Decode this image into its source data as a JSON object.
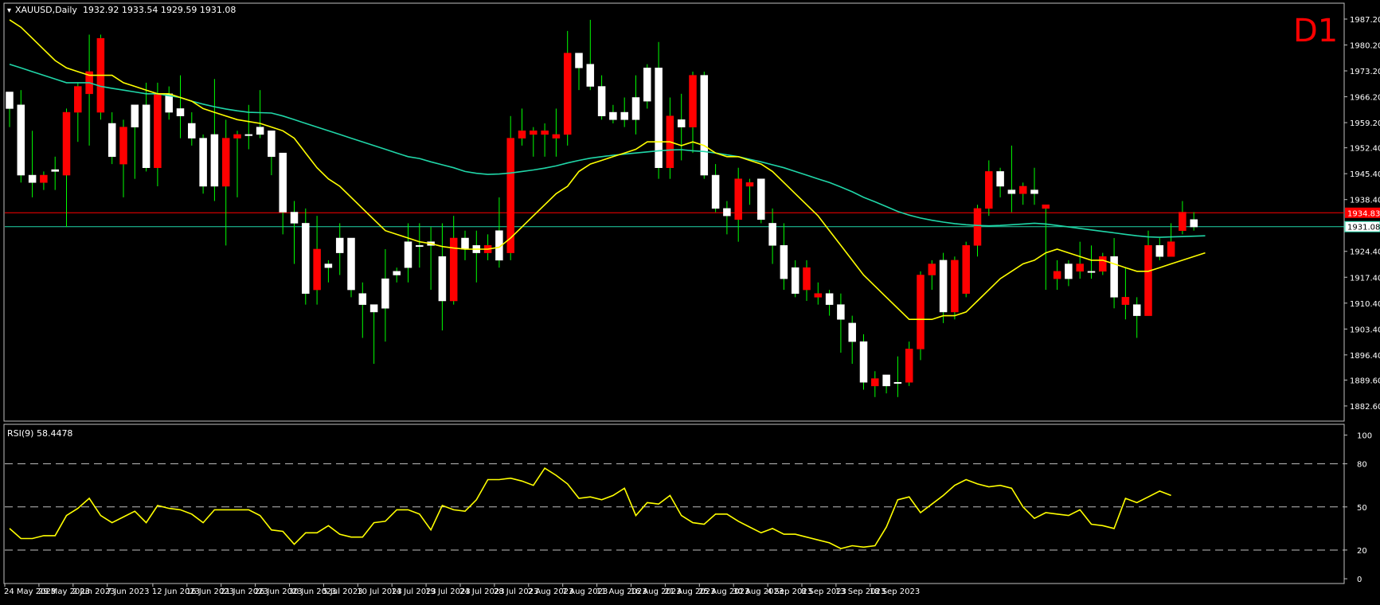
{
  "header": {
    "symbol_line": "XAUUSD,Daily  1932.92 1933.54 1929.59 1931.08",
    "timeframe_badge": "D1"
  },
  "colors": {
    "background": "#000000",
    "bull_fill": "#ffffff",
    "bear_fill": "#ff0000",
    "wick": "#00ff00",
    "ma_fast": "#ffff00",
    "ma_slow": "#20d6a8",
    "rsi_line": "#ffff00",
    "price_line_red": "#ff0000",
    "price_line_teal": "#20d6a8",
    "axis_text": "#ffffff",
    "d1_text": "#ff0000"
  },
  "chart_data": [
    {
      "type": "candlestick",
      "title": "XAUUSD,Daily",
      "ohlc_header": {
        "open": 1932.92,
        "high": 1933.54,
        "low": 1929.59,
        "close": 1931.08
      },
      "ylim": [
        1882.6,
        1987.2
      ],
      "y_ticks": [
        "1987.20",
        "1980.20",
        "1973.20",
        "1966.20",
        "1959.20",
        "1952.40",
        "1945.40",
        "1938.40",
        "1931.40",
        "1924.40",
        "1917.40",
        "1910.40",
        "1903.40",
        "1896.40",
        "1889.60",
        "1882.60"
      ],
      "price_markers": [
        {
          "label": "1934.83",
          "value": 1934.83,
          "style": "red"
        },
        {
          "label": "1931.08",
          "value": 1931.08,
          "style": "teal"
        }
      ],
      "x_labels": [
        "24 May 2023",
        "29 May 2023",
        "2 Jun 2023",
        "7 Jun 2023",
        "12 Jun 2023",
        "16 Jun 2023",
        "21 Jun 2023",
        "26 Jun 2023",
        "30 Jun 2023",
        "5 Jul 2023",
        "10 Jul 2023",
        "14 Jul 2023",
        "19 Jul 2023",
        "24 Jul 2023",
        "28 Jul 2023",
        "2 Aug 2023",
        "7 Aug 2023",
        "11 Aug 2023",
        "16 Aug 2023",
        "21 Aug 2023",
        "25 Aug 2023",
        "30 Aug 2023",
        "4 Sep 2023",
        "8 Sep 2023",
        "13 Sep 2023",
        "18 Sep 2023"
      ],
      "candles": [
        {
          "o": 1963.0,
          "h": 1966.0,
          "l": 1958.0,
          "c": 1967.5
        },
        {
          "o": 1945.0,
          "h": 1968.0,
          "l": 1943.0,
          "c": 1964.0
        },
        {
          "o": 1943.0,
          "h": 1957.0,
          "l": 1939.0,
          "c": 1945.0
        },
        {
          "o": 1945.0,
          "h": 1946.0,
          "l": 1941.0,
          "c": 1943.0
        },
        {
          "o": 1946.0,
          "h": 1950.0,
          "l": 1941.0,
          "c": 1946.5
        },
        {
          "o": 1962.0,
          "h": 1963.0,
          "l": 1931.0,
          "c": 1945.0
        },
        {
          "o": 1969.0,
          "h": 1970.0,
          "l": 1954.0,
          "c": 1962.0
        },
        {
          "o": 1973.0,
          "h": 1983.0,
          "l": 1953.0,
          "c": 1967.0
        },
        {
          "o": 1982.0,
          "h": 1983.0,
          "l": 1960.0,
          "c": 1962.0
        },
        {
          "o": 1950.0,
          "h": 1962.0,
          "l": 1948.0,
          "c": 1959.0
        },
        {
          "o": 1958.0,
          "h": 1960.0,
          "l": 1939.0,
          "c": 1948.0
        },
        {
          "o": 1958.0,
          "h": 1964.0,
          "l": 1944.0,
          "c": 1964.0
        },
        {
          "o": 1947.0,
          "h": 1970.0,
          "l": 1946.0,
          "c": 1964.0
        },
        {
          "o": 1967.0,
          "h": 1970.0,
          "l": 1942.0,
          "c": 1947.0
        },
        {
          "o": 1962.0,
          "h": 1969.0,
          "l": 1960.0,
          "c": 1967.0
        },
        {
          "o": 1961.0,
          "h": 1972.0,
          "l": 1955.0,
          "c": 1963.0
        },
        {
          "o": 1955.0,
          "h": 1962.0,
          "l": 1953.0,
          "c": 1959.0
        },
        {
          "o": 1942.0,
          "h": 1956.0,
          "l": 1940.0,
          "c": 1955.0
        },
        {
          "o": 1942.0,
          "h": 1971.0,
          "l": 1938.0,
          "c": 1956.0
        },
        {
          "o": 1955.0,
          "h": 1960.0,
          "l": 1926.0,
          "c": 1942.0
        },
        {
          "o": 1956.0,
          "h": 1957.0,
          "l": 1939.0,
          "c": 1955.0
        },
        {
          "o": 1956.0,
          "h": 1964.0,
          "l": 1952.0,
          "c": 1956.0
        },
        {
          "o": 1956.0,
          "h": 1968.0,
          "l": 1955.0,
          "c": 1958.0
        },
        {
          "o": 1950.0,
          "h": 1957.0,
          "l": 1945.0,
          "c": 1957.0
        },
        {
          "o": 1935.0,
          "h": 1951.0,
          "l": 1929.0,
          "c": 1951.0
        },
        {
          "o": 1932.0,
          "h": 1938.0,
          "l": 1921.0,
          "c": 1935.0
        },
        {
          "o": 1913.0,
          "h": 1936.0,
          "l": 1910.0,
          "c": 1932.0
        },
        {
          "o": 1925.0,
          "h": 1934.0,
          "l": 1910.0,
          "c": 1914.0
        },
        {
          "o": 1920.0,
          "h": 1922.0,
          "l": 1916.0,
          "c": 1921.0
        },
        {
          "o": 1924.0,
          "h": 1932.0,
          "l": 1918.0,
          "c": 1928.0
        },
        {
          "o": 1914.0,
          "h": 1927.0,
          "l": 1912.0,
          "c": 1928.0
        },
        {
          "o": 1910.0,
          "h": 1916.0,
          "l": 1901.0,
          "c": 1913.0
        },
        {
          "o": 1908.0,
          "h": 1910.0,
          "l": 1894.0,
          "c": 1910.0
        },
        {
          "o": 1909.0,
          "h": 1925.0,
          "l": 1900.0,
          "c": 1917.0
        },
        {
          "o": 1918.0,
          "h": 1920.0,
          "l": 1916.0,
          "c": 1919.0
        },
        {
          "o": 1920.0,
          "h": 1932.0,
          "l": 1916.0,
          "c": 1927.0
        },
        {
          "o": 1926.0,
          "h": 1932.0,
          "l": 1920.0,
          "c": 1926.0
        },
        {
          "o": 1926.0,
          "h": 1931.0,
          "l": 1914.0,
          "c": 1927.0
        },
        {
          "o": 1911.0,
          "h": 1932.0,
          "l": 1903.0,
          "c": 1923.0
        },
        {
          "o": 1928.0,
          "h": 1934.0,
          "l": 1910.0,
          "c": 1911.0
        },
        {
          "o": 1925.0,
          "h": 1930.0,
          "l": 1922.0,
          "c": 1928.0
        },
        {
          "o": 1924.0,
          "h": 1930.0,
          "l": 1916.0,
          "c": 1926.0
        },
        {
          "o": 1926.0,
          "h": 1929.0,
          "l": 1922.0,
          "c": 1924.0
        },
        {
          "o": 1922.0,
          "h": 1939.0,
          "l": 1920.0,
          "c": 1930.0
        },
        {
          "o": 1955.0,
          "h": 1961.0,
          "l": 1922.0,
          "c": 1924.0
        },
        {
          "o": 1957.0,
          "h": 1963.0,
          "l": 1953.0,
          "c": 1955.0
        },
        {
          "o": 1957.0,
          "h": 1958.0,
          "l": 1950.0,
          "c": 1956.0
        },
        {
          "o": 1957.0,
          "h": 1959.0,
          "l": 1950.0,
          "c": 1956.0
        },
        {
          "o": 1956.0,
          "h": 1963.0,
          "l": 1950.0,
          "c": 1955.0
        },
        {
          "o": 1978.0,
          "h": 1984.0,
          "l": 1953.0,
          "c": 1956.0
        },
        {
          "o": 1974.0,
          "h": 1978.0,
          "l": 1968.0,
          "c": 1978.0
        },
        {
          "o": 1969.0,
          "h": 1987.0,
          "l": 1968.0,
          "c": 1975.0
        },
        {
          "o": 1961.0,
          "h": 1972.0,
          "l": 1960.0,
          "c": 1969.0
        },
        {
          "o": 1960.0,
          "h": 1964.0,
          "l": 1959.0,
          "c": 1962.0
        },
        {
          "o": 1960.0,
          "h": 1966.0,
          "l": 1958.0,
          "c": 1962.0
        },
        {
          "o": 1960.0,
          "h": 1972.0,
          "l": 1956.0,
          "c": 1966.0
        },
        {
          "o": 1965.0,
          "h": 1975.0,
          "l": 1963.0,
          "c": 1974.0
        },
        {
          "o": 1947.0,
          "h": 1981.0,
          "l": 1944.0,
          "c": 1974.0
        },
        {
          "o": 1961.0,
          "h": 1966.0,
          "l": 1944.0,
          "c": 1947.0
        },
        {
          "o": 1958.0,
          "h": 1967.0,
          "l": 1949.0,
          "c": 1960.0
        },
        {
          "o": 1972.0,
          "h": 1973.0,
          "l": 1951.0,
          "c": 1958.0
        },
        {
          "o": 1945.0,
          "h": 1973.0,
          "l": 1944.0,
          "c": 1972.0
        },
        {
          "o": 1936.0,
          "h": 1948.0,
          "l": 1935.0,
          "c": 1945.0
        },
        {
          "o": 1934.0,
          "h": 1938.0,
          "l": 1929.0,
          "c": 1936.0
        },
        {
          "o": 1944.0,
          "h": 1947.0,
          "l": 1927.0,
          "c": 1933.0
        },
        {
          "o": 1943.0,
          "h": 1944.0,
          "l": 1937.0,
          "c": 1942.0
        },
        {
          "o": 1933.0,
          "h": 1944.0,
          "l": 1932.0,
          "c": 1944.0
        },
        {
          "o": 1926.0,
          "h": 1936.0,
          "l": 1921.0,
          "c": 1932.0
        },
        {
          "o": 1917.0,
          "h": 1932.0,
          "l": 1914.0,
          "c": 1926.0
        },
        {
          "o": 1913.0,
          "h": 1922.0,
          "l": 1912.0,
          "c": 1920.0
        },
        {
          "o": 1920.0,
          "h": 1922.0,
          "l": 1911.0,
          "c": 1914.0
        },
        {
          "o": 1913.0,
          "h": 1916.0,
          "l": 1910.0,
          "c": 1912.0
        },
        {
          "o": 1910.0,
          "h": 1914.0,
          "l": 1907.0,
          "c": 1913.0
        },
        {
          "o": 1906.0,
          "h": 1913.0,
          "l": 1897.0,
          "c": 1910.0
        },
        {
          "o": 1900.0,
          "h": 1907.0,
          "l": 1894.0,
          "c": 1905.0
        },
        {
          "o": 1889.0,
          "h": 1902.0,
          "l": 1887.0,
          "c": 1900.0
        },
        {
          "o": 1890.0,
          "h": 1892.0,
          "l": 1885.0,
          "c": 1888.0
        },
        {
          "o": 1888.0,
          "h": 1891.0,
          "l": 1886.0,
          "c": 1891.0
        },
        {
          "o": 1889.0,
          "h": 1896.0,
          "l": 1885.0,
          "c": 1889.0
        },
        {
          "o": 1898.0,
          "h": 1900.0,
          "l": 1888.0,
          "c": 1889.0
        },
        {
          "o": 1918.0,
          "h": 1919.0,
          "l": 1895.0,
          "c": 1898.0
        },
        {
          "o": 1921.0,
          "h": 1922.0,
          "l": 1914.0,
          "c": 1918.0
        },
        {
          "o": 1908.0,
          "h": 1924.0,
          "l": 1905.0,
          "c": 1922.0
        },
        {
          "o": 1922.0,
          "h": 1923.0,
          "l": 1906.0,
          "c": 1908.0
        },
        {
          "o": 1926.0,
          "h": 1927.0,
          "l": 1912.0,
          "c": 1913.0
        },
        {
          "o": 1936.0,
          "h": 1937.0,
          "l": 1923.0,
          "c": 1926.0
        },
        {
          "o": 1946.0,
          "h": 1949.0,
          "l": 1934.0,
          "c": 1936.0
        },
        {
          "o": 1942.0,
          "h": 1947.0,
          "l": 1939.0,
          "c": 1946.0
        },
        {
          "o": 1940.0,
          "h": 1953.0,
          "l": 1935.0,
          "c": 1941.0
        },
        {
          "o": 1942.0,
          "h": 1943.0,
          "l": 1937.0,
          "c": 1940.0
        },
        {
          "o": 1940.0,
          "h": 1947.0,
          "l": 1937.0,
          "c": 1941.0
        },
        {
          "o": 1937.0,
          "h": 1937.0,
          "l": 1914.0,
          "c": 1936.0
        },
        {
          "o": 1919.0,
          "h": 1922.0,
          "l": 1914.0,
          "c": 1917.0
        },
        {
          "o": 1917.0,
          "h": 1922.0,
          "l": 1915.0,
          "c": 1921.0
        },
        {
          "o": 1921.0,
          "h": 1927.0,
          "l": 1917.0,
          "c": 1919.0
        },
        {
          "o": 1919.0,
          "h": 1926.0,
          "l": 1917.0,
          "c": 1919.0
        },
        {
          "o": 1923.0,
          "h": 1924.0,
          "l": 1918.0,
          "c": 1919.0
        },
        {
          "o": 1912.0,
          "h": 1928.0,
          "l": 1909.0,
          "c": 1923.0
        },
        {
          "o": 1912.0,
          "h": 1920.0,
          "l": 1906.0,
          "c": 1910.0
        },
        {
          "o": 1907.0,
          "h": 1912.0,
          "l": 1901.0,
          "c": 1910.0
        },
        {
          "o": 1926.0,
          "h": 1930.0,
          "l": 1907.0,
          "c": 1907.0
        },
        {
          "o": 1923.0,
          "h": 1928.0,
          "l": 1922.0,
          "c": 1926.0
        },
        {
          "o": 1927.0,
          "h": 1932.0,
          "l": 1923.0,
          "c": 1923.0
        },
        {
          "o": 1935.0,
          "h": 1938.0,
          "l": 1929.0,
          "c": 1930.0
        },
        {
          "o": 1931.0,
          "h": 1935.0,
          "l": 1930.0,
          "c": 1933.0
        }
      ],
      "ma_fast": [
        1987,
        1985,
        1982,
        1979,
        1976,
        1974,
        1973,
        1972,
        1972,
        1972,
        1970,
        1969,
        1968,
        1967,
        1967,
        1966,
        1965,
        1963,
        1962,
        1961,
        1960,
        1959.5,
        1959,
        1958,
        1957,
        1955,
        1951,
        1947,
        1944,
        1942,
        1939,
        1936,
        1933,
        1930,
        1929,
        1928,
        1927,
        1926.5,
        1925.7,
        1925.3,
        1925,
        1925,
        1925,
        1925.5,
        1928,
        1931,
        1934,
        1937,
        1940,
        1942,
        1946,
        1948,
        1949,
        1950,
        1951,
        1952,
        1954,
        1954,
        1954,
        1953,
        1954,
        1953,
        1951,
        1950,
        1950,
        1949,
        1948,
        1946,
        1943,
        1940,
        1937,
        1934,
        1930,
        1926,
        1922,
        1918,
        1915,
        1912,
        1909,
        1906,
        1906,
        1906,
        1907,
        1907,
        1908,
        1911,
        1914,
        1917,
        1919,
        1921,
        1922,
        1924,
        1925,
        1924,
        1923,
        1922,
        1922,
        1921,
        1920,
        1919,
        1919,
        1920,
        1921,
        1922,
        1923,
        1924
      ],
      "ma_slow": [
        1975,
        1974,
        1973,
        1972,
        1971,
        1970,
        1970,
        1970,
        1969,
        1968.5,
        1968,
        1967.5,
        1967,
        1967,
        1966.5,
        1966,
        1965,
        1964.2,
        1963.5,
        1962.9,
        1962.4,
        1962,
        1961.9,
        1961.8,
        1961,
        1960,
        1959,
        1958,
        1957,
        1956,
        1955,
        1954,
        1953,
        1952,
        1951,
        1950,
        1949.5,
        1948.6,
        1947.8,
        1947,
        1946,
        1945.5,
        1945.2,
        1945.3,
        1945.6,
        1946,
        1946.4,
        1946.9,
        1947.5,
        1948.3,
        1949,
        1949.6,
        1950,
        1950.4,
        1950.7,
        1951,
        1951.3,
        1951.6,
        1951.8,
        1951.9,
        1951.6,
        1951.4,
        1951.0,
        1950.5,
        1950.0,
        1949.3,
        1948.6,
        1947.8,
        1947,
        1946,
        1945,
        1944,
        1943,
        1941.8,
        1940.5,
        1939,
        1937.8,
        1936.5,
        1935.2,
        1934.2,
        1933.4,
        1932.8,
        1932.3,
        1931.9,
        1931.6,
        1931.4,
        1931.3,
        1931.4,
        1931.6,
        1931.8,
        1932.0,
        1931.8,
        1931.4,
        1931.0,
        1930.6,
        1930.2,
        1929.8,
        1929.4,
        1929.0,
        1928.6,
        1928.3,
        1928.2,
        1928.3,
        1928.4,
        1928.5,
        1928.6
      ],
      "ma_fast_label": "",
      "ma_slow_label": ""
    },
    {
      "type": "line",
      "title": "RSI(9) 58.4478",
      "ylim": [
        0,
        100
      ],
      "y_ticks": [
        "100",
        "80",
        "50",
        "20",
        "0"
      ],
      "levels": [
        80,
        50,
        20
      ],
      "values": [
        35,
        28,
        28,
        30,
        30,
        44,
        49,
        56,
        44,
        39,
        43,
        47,
        39,
        51,
        49,
        48,
        45,
        39,
        48,
        48,
        48,
        48,
        44,
        34,
        33,
        24,
        32,
        32,
        37,
        31,
        29,
        29,
        39,
        40,
        48,
        48,
        45,
        34,
        51,
        48,
        47,
        55,
        69,
        69,
        70,
        68,
        65,
        77,
        72,
        66,
        56,
        57,
        55,
        58,
        63,
        44,
        53,
        52,
        58,
        44,
        39,
        38,
        45,
        45,
        40,
        36,
        32,
        35,
        31,
        31,
        29,
        27,
        25,
        21,
        23,
        22,
        23,
        36,
        55,
        57,
        46,
        52,
        58,
        65,
        69,
        66,
        64,
        65,
        63,
        50,
        42,
        46,
        45,
        44,
        48,
        38,
        37,
        35,
        56,
        53,
        57,
        61,
        58
      ],
      "x_labels": [
        "24 May 2023",
        "29 May 2023",
        "2 Jun 2023",
        "7 Jun 2023",
        "12 Jun 2023",
        "16 Jun 2023",
        "21 Jun 2023",
        "26 Jun 2023",
        "30 Jun 2023",
        "5 Jul 2023",
        "10 Jul 2023",
        "14 Jul 2023",
        "19 Jul 2023",
        "24 Jul 2023",
        "28 Jul 2023",
        "2 Aug 2023",
        "7 Aug 2023",
        "11 Aug 2023",
        "16 Aug 2023",
        "21 Aug 2023",
        "25 Aug 2023",
        "30 Aug 2023",
        "4 Sep 2023",
        "8 Sep 2023",
        "13 Sep 2023",
        "18 Sep 2023"
      ]
    }
  ]
}
